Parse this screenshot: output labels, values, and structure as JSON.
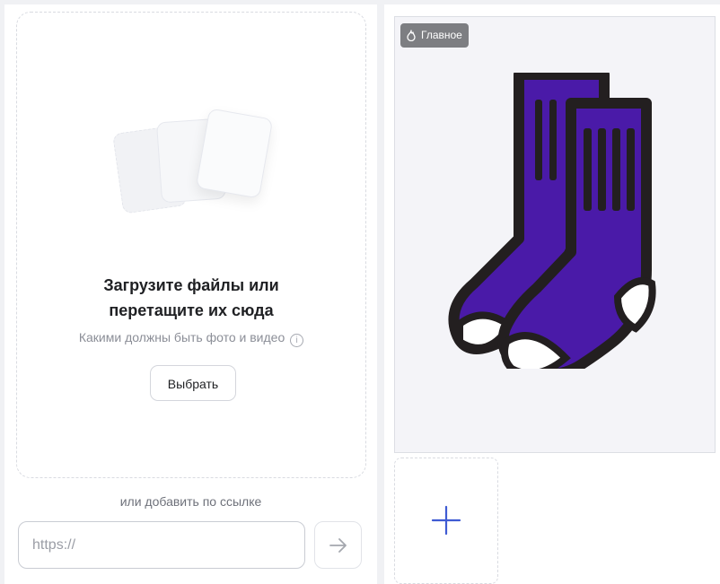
{
  "upload": {
    "title_line1": "Загрузите файлы или",
    "title_line2": "перетащите их сюда",
    "requirements": "Какими должны быть фото и видео",
    "choose_button": "Выбрать",
    "or_link_text": "или добавить по ссылке",
    "url_placeholder": "https://"
  },
  "gallery": {
    "main_badge": "Главное",
    "main_photo_icon": "socks-image",
    "add_icon": "plus-icon"
  },
  "colors": {
    "accent": "#3f5bd3",
    "sock_fill": "#4a1aa8",
    "badge_bg": "#7d7e82"
  }
}
